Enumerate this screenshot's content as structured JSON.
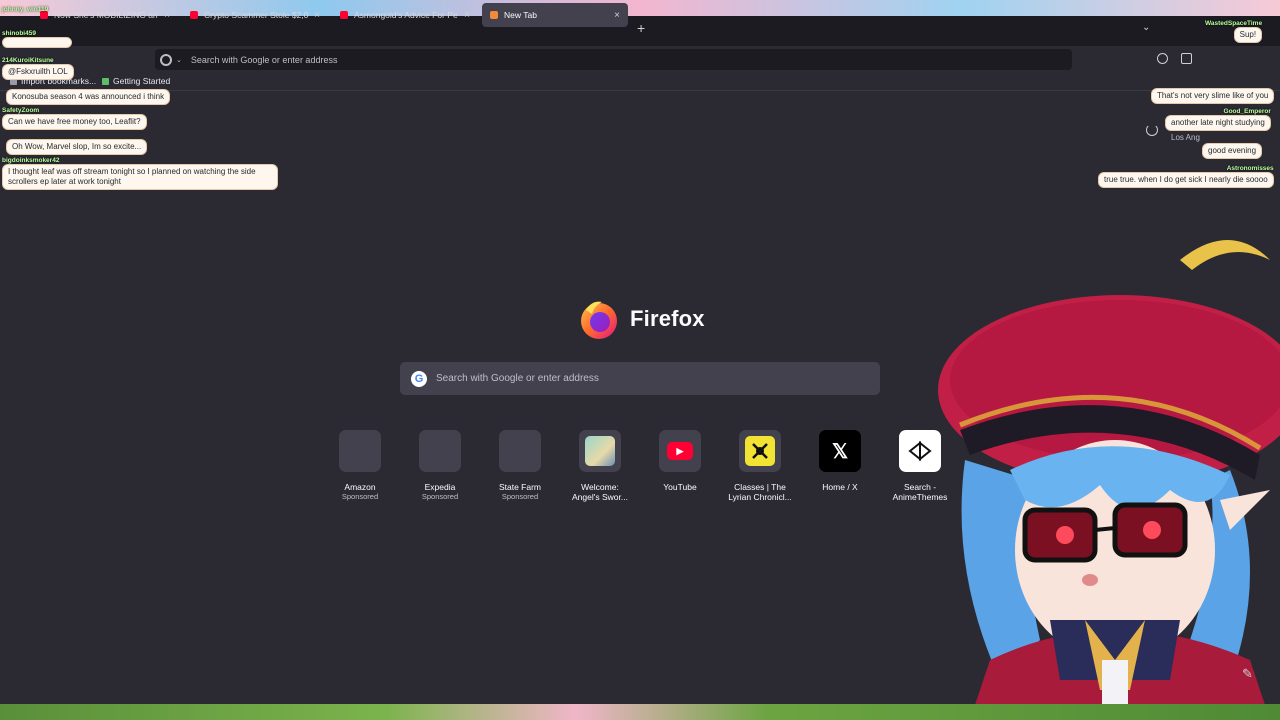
{
  "tabs": [
    {
      "label": "Now She's MOBILIZING an Arm",
      "fav_color": "#ff0033",
      "active": false
    },
    {
      "label": "Crypto Scammer Stole $2,000,0",
      "fav_color": "#ff0033",
      "active": false
    },
    {
      "label": "Asmongold's Advice For People",
      "fav_color": "#ff0033",
      "active": false
    },
    {
      "label": "New Tab",
      "fav_color": "#f28a3a",
      "active": true
    }
  ],
  "tab_close": "×",
  "new_tab": "+",
  "list_tabs": "⌄",
  "urlbar": {
    "placeholder": "Search with Google or enter address",
    "chevron": "⌄"
  },
  "bookmarks": [
    {
      "label": "Import bookmarks..."
    },
    {
      "label": "Getting Started"
    }
  ],
  "brand": {
    "name": "Firefox"
  },
  "search": {
    "placeholder": "Search with Google or enter address",
    "engine_letter": "G"
  },
  "top_sites": [
    {
      "title": "Amazon",
      "sub": "Sponsored",
      "icon": "blank-tile"
    },
    {
      "title": "Expedia",
      "sub": "Sponsored",
      "icon": "blank-tile"
    },
    {
      "title": "State Farm",
      "sub": "Sponsored",
      "icon": "blank-tile"
    },
    {
      "title": "Welcome:",
      "title2": "Angel's Swor...",
      "sub": "",
      "icon": "anime-art-icon"
    },
    {
      "title": "YouTube",
      "sub": "",
      "icon": "youtube-icon"
    },
    {
      "title": "Classes | The",
      "title2": "Lyrian Chronicl...",
      "sub": "",
      "icon": "lyrian-icon"
    },
    {
      "title": "Home / X",
      "sub": "",
      "icon": "x-icon"
    },
    {
      "title": "Search -",
      "title2": "AnimeThemes",
      "sub": "",
      "icon": "animethemes-icon"
    }
  ],
  "chat_left": [
    {
      "user": "johnny_win119",
      "text": ""
    },
    {
      "user": "shinobi459",
      "text": ""
    },
    {
      "user": "214KuroiKitsune",
      "text": "@Fskxruilth LOL"
    },
    {
      "user": "",
      "text": "Konosuba season 4 was announced i think"
    },
    {
      "user": "SafetyZoom",
      "text": "Can we have free money too, Leaflit?"
    },
    {
      "user": "",
      "text": "Oh Wow, Marvel slop, Im so excite..."
    },
    {
      "user": "bigdoinksmoker42",
      "text": "I thought leaf was off stream tonight so I planned on watching the side scrollers ep later at work tonight"
    }
  ],
  "chat_right": [
    {
      "user": "WastedSpaceTime",
      "text": "Sup!"
    },
    {
      "user": "",
      "text": "That's not very slime like of you"
    },
    {
      "user": "Good_Emperor",
      "text": "another late night studying"
    },
    {
      "user": "",
      "text": "good evening"
    },
    {
      "user": "Astronomisses",
      "text": "true true. when I do get sick I nearly die soooo"
    }
  ],
  "location_text": "Los Ang",
  "edit_glyph": "✎",
  "x_glyph": "𝕏",
  "yt_glyph": "▶",
  "colors": {
    "background": "#2b2a33",
    "tile": "#42414d",
    "tabbar": "#1c1b22",
    "youtube_red": "#ff0033"
  }
}
